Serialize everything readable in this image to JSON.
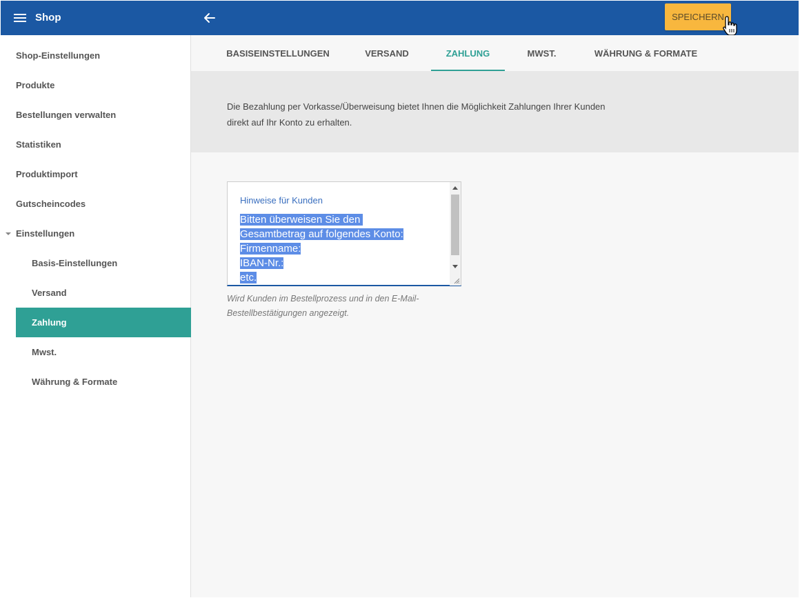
{
  "header": {
    "title": "Shop",
    "save_label": "SPEICHERN",
    "colors": {
      "bar": "#1b58a3",
      "save": "#f8b73e"
    }
  },
  "sidebar": {
    "items": [
      {
        "label": "Shop-Einstellungen"
      },
      {
        "label": "Produkte"
      },
      {
        "label": "Bestellungen verwalten"
      },
      {
        "label": "Statistiken"
      },
      {
        "label": "Produktimport"
      },
      {
        "label": "Gutscheincodes"
      },
      {
        "label": "Einstellungen"
      }
    ],
    "subitems": [
      {
        "label": "Basis-Einstellungen"
      },
      {
        "label": "Versand"
      },
      {
        "label": "Zahlung"
      },
      {
        "label": "Mwst."
      },
      {
        "label": "Währung & Formate"
      }
    ],
    "active": "Zahlung",
    "active_color": "#2fa095"
  },
  "tabs": [
    {
      "label": "BASISEINSTELLUNGEN"
    },
    {
      "label": "VERSAND"
    },
    {
      "label": "ZAHLUNG"
    },
    {
      "label": "MWST."
    },
    {
      "label": "WÄHRUNG & FORMATE"
    }
  ],
  "active_tab": "ZAHLUNG",
  "info": {
    "line1": "Die Bezahlung per Vorkasse/Überweisung bietet Ihnen die Möglichkeit Zahlungen Ihrer Kunden",
    "line2": "direkt auf Ihr Konto zu erhalten."
  },
  "field": {
    "label": "Hinweise für Kunden",
    "lines": [
      "Bitten überweisen Sie den ",
      "Gesamtbetrag auf folgendes Konto:",
      "Firmenname:",
      "IBAN-Nr.:",
      "etc."
    ],
    "hint_line1": "Wird Kunden im Bestellprozess und in den E-Mail-",
    "hint_line2": "Bestellbestätigungen angezeigt."
  }
}
